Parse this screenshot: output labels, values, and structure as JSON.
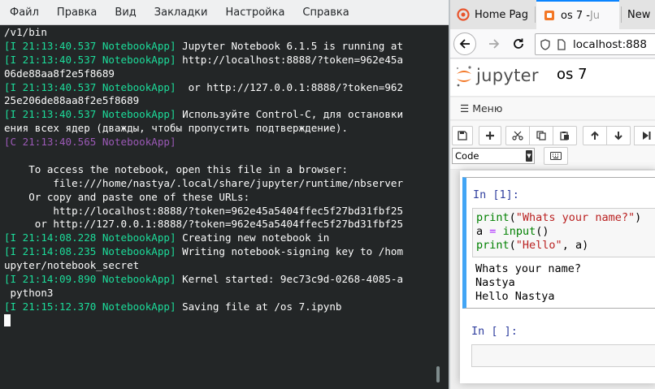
{
  "terminal": {
    "menu": [
      "Файл",
      "Правка",
      "Вид",
      "Закладки",
      "Настройка",
      "Справка"
    ],
    "lines": [
      [
        {
          "t": "/v1/bin",
          "c": "white"
        }
      ],
      [
        {
          "t": "[I 21:13:40.537 NotebookApp]",
          "c": "green"
        },
        {
          "t": " Jupyter Notebook 6.1.5 is running at",
          "c": "white"
        }
      ],
      [
        {
          "t": "[I 21:13:40.537 NotebookApp]",
          "c": "green"
        },
        {
          "t": " http://localhost:8888/?token=962e45a",
          "c": "white"
        }
      ],
      [
        {
          "t": "06de88aa8f2e5f8689",
          "c": "white"
        }
      ],
      [
        {
          "t": "[I 21:13:40.537 NotebookApp]",
          "c": "green"
        },
        {
          "t": "  or http://127.0.0.1:8888/?token=962",
          "c": "white"
        }
      ],
      [
        {
          "t": "25e206de88aa8f2e5f8689",
          "c": "white"
        }
      ],
      [
        {
          "t": "[I 21:13:40.537 NotebookApp]",
          "c": "green"
        },
        {
          "t": " Используйте Control-C, для остановки",
          "c": "white"
        }
      ],
      [
        {
          "t": "ения всех ядер (дважды, чтобы пропустить подтверждение).",
          "c": "white"
        }
      ],
      [
        {
          "t": "[C 21:13:40.565 NotebookApp]",
          "c": "purple"
        }
      ],
      [
        {
          "t": "",
          "c": "white"
        }
      ],
      [
        {
          "t": "    To access the notebook, open this file in a browser:",
          "c": "white"
        }
      ],
      [
        {
          "t": "        file:///home/nastya/.local/share/jupyter/runtime/nbserver",
          "c": "white"
        }
      ],
      [
        {
          "t": "    Or copy and paste one of these URLs:",
          "c": "white"
        }
      ],
      [
        {
          "t": "        http://localhost:8888/?token=962e45a5404ffec5f27bd31fbf25",
          "c": "white"
        }
      ],
      [
        {
          "t": "     or http://127.0.0.1:8888/?token=962e45a5404ffec5f27bd31fbf25",
          "c": "white"
        }
      ],
      [
        {
          "t": "[I 21:14:08.228 NotebookApp]",
          "c": "green"
        },
        {
          "t": " Creating new notebook in",
          "c": "white"
        }
      ],
      [
        {
          "t": "[I 21:14:08.235 NotebookApp]",
          "c": "green"
        },
        {
          "t": " Writing notebook-signing key to /hom",
          "c": "white"
        }
      ],
      [
        {
          "t": "upyter/notebook_secret",
          "c": "white"
        }
      ],
      [
        {
          "t": "[I 21:14:09.890 NotebookApp]",
          "c": "green"
        },
        {
          "t": " Kernel started: 9ec73c9d-0268-4085-a",
          "c": "white"
        }
      ],
      [
        {
          "t": " python3",
          "c": "white"
        }
      ],
      [
        {
          "t": "[I 21:15:12.370 NotebookApp]",
          "c": "green"
        },
        {
          "t": " Saving file at /os 7.ipynb",
          "c": "white"
        }
      ]
    ]
  },
  "browser": {
    "tabs": {
      "tab1_label": "Home Pag",
      "tab2_label": "os 7 - ",
      "tab2_fade": "Ju",
      "tab3_label": "New"
    },
    "url": "localhost:888",
    "jupyter": {
      "wordmark": "jupyter",
      "notebook_name": "os 7",
      "menu_label": "Меню",
      "cell_type": "Code"
    },
    "cells": {
      "cell1_prompt": "In [1]:",
      "cell1_output": "Whats your name?\nNastya\nHello Nastya",
      "cell2_prompt": "In [ ]:"
    },
    "code_tokens": {
      "print": "print",
      "open": "(",
      "close": ")",
      "str1": "\"Whats your name?\"",
      "a": "a",
      "eq": "=",
      "input": "input",
      "parens": "()",
      "str2": "\"Hello\"",
      "comma_a": ", a)"
    }
  },
  "colors": {
    "terminal_bg": "#232627",
    "terminal_green": "#1cdc9a",
    "terminal_purple": "#9b59b6",
    "jupyter_orange": "#f37726",
    "cell_selected": "#42a5f5",
    "prompt_blue": "#303f9f"
  }
}
